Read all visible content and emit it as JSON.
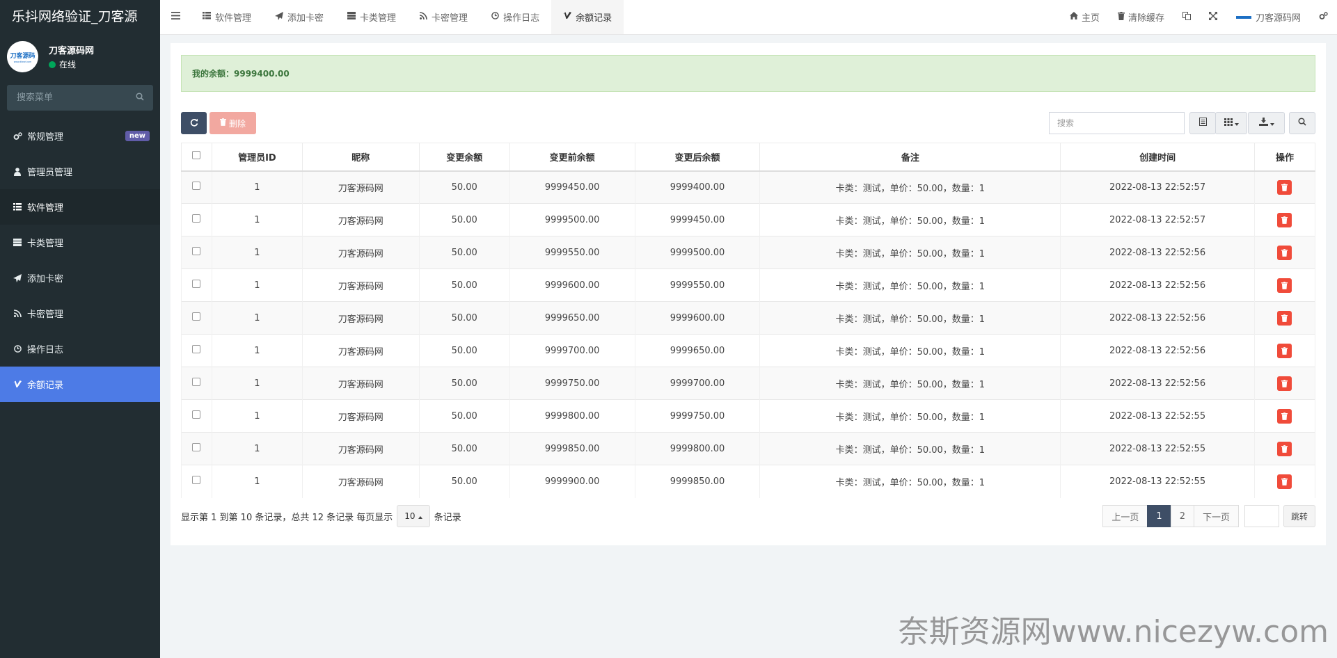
{
  "app": {
    "brand": "乐抖网络验证_刀客源",
    "user_name": "刀客源码网",
    "user_status": "在线",
    "avatar_text": "刀客源码",
    "avatar_subtext": "www.dkewl.com"
  },
  "sidebar": {
    "search_placeholder": "搜索菜单",
    "items": [
      {
        "label": "常规管理",
        "icon": "cogs-icon",
        "badge": "new"
      },
      {
        "label": "管理员管理",
        "icon": "user-icon"
      },
      {
        "label": "软件管理",
        "icon": "list-icon"
      },
      {
        "label": "卡类管理",
        "icon": "server-icon"
      },
      {
        "label": "添加卡密",
        "icon": "paper-plane-icon"
      },
      {
        "label": "卡密管理",
        "icon": "rss-icon"
      },
      {
        "label": "操作日志",
        "icon": "clock-icon"
      },
      {
        "label": "余额记录",
        "icon": "vimeo-icon"
      }
    ]
  },
  "topnav": {
    "tabs": [
      {
        "label": "软件管理"
      },
      {
        "label": "添加卡密"
      },
      {
        "label": "卡类管理"
      },
      {
        "label": "卡密管理"
      },
      {
        "label": "操作日志"
      },
      {
        "label": "余额记录"
      }
    ],
    "right": {
      "home": "主页",
      "clear_cache": "清除缓存",
      "user": "刀客源码网"
    }
  },
  "balance": {
    "label": "我的余额：9999400.00"
  },
  "toolbar": {
    "delete_label": "删除",
    "search_placeholder": "搜索"
  },
  "table": {
    "columns": [
      "管理员ID",
      "昵称",
      "变更余额",
      "变更前余额",
      "变更后余额",
      "备注",
      "创建时间",
      "操作"
    ],
    "rows": [
      {
        "admin_id": "1",
        "nickname": "刀客源码网",
        "change": "50.00",
        "before": "9999450.00",
        "after": "9999400.00",
        "remark": "卡类：测试，单价：50.00，数量：1",
        "time": "2022-08-13 22:52:57"
      },
      {
        "admin_id": "1",
        "nickname": "刀客源码网",
        "change": "50.00",
        "before": "9999500.00",
        "after": "9999450.00",
        "remark": "卡类：测试，单价：50.00，数量：1",
        "time": "2022-08-13 22:52:57"
      },
      {
        "admin_id": "1",
        "nickname": "刀客源码网",
        "change": "50.00",
        "before": "9999550.00",
        "after": "9999500.00",
        "remark": "卡类：测试，单价：50.00，数量：1",
        "time": "2022-08-13 22:52:56"
      },
      {
        "admin_id": "1",
        "nickname": "刀客源码网",
        "change": "50.00",
        "before": "9999600.00",
        "after": "9999550.00",
        "remark": "卡类：测试，单价：50.00，数量：1",
        "time": "2022-08-13 22:52:56"
      },
      {
        "admin_id": "1",
        "nickname": "刀客源码网",
        "change": "50.00",
        "before": "9999650.00",
        "after": "9999600.00",
        "remark": "卡类：测试，单价：50.00，数量：1",
        "time": "2022-08-13 22:52:56"
      },
      {
        "admin_id": "1",
        "nickname": "刀客源码网",
        "change": "50.00",
        "before": "9999700.00",
        "after": "9999650.00",
        "remark": "卡类：测试，单价：50.00，数量：1",
        "time": "2022-08-13 22:52:56"
      },
      {
        "admin_id": "1",
        "nickname": "刀客源码网",
        "change": "50.00",
        "before": "9999750.00",
        "after": "9999700.00",
        "remark": "卡类：测试，单价：50.00，数量：1",
        "time": "2022-08-13 22:52:56"
      },
      {
        "admin_id": "1",
        "nickname": "刀客源码网",
        "change": "50.00",
        "before": "9999800.00",
        "after": "9999750.00",
        "remark": "卡类：测试，单价：50.00，数量：1",
        "time": "2022-08-13 22:52:55"
      },
      {
        "admin_id": "1",
        "nickname": "刀客源码网",
        "change": "50.00",
        "before": "9999850.00",
        "after": "9999800.00",
        "remark": "卡类：测试，单价：50.00，数量：1",
        "time": "2022-08-13 22:52:55"
      },
      {
        "admin_id": "1",
        "nickname": "刀客源码网",
        "change": "50.00",
        "before": "9999900.00",
        "after": "9999850.00",
        "remark": "卡类：测试，单价：50.00，数量：1",
        "time": "2022-08-13 22:52:55"
      }
    ]
  },
  "pager": {
    "info_prefix": "显示第 1 到第 10 条记录，总共 12 条记录 每页显示",
    "page_size": "10",
    "info_suffix": "条记录",
    "prev": "上一页",
    "pages": [
      "1",
      "2"
    ],
    "next": "下一页",
    "jump": "跳转"
  },
  "watermark": "奈斯资源网www.nicezyw.com",
  "colors": {
    "sidebar_bg": "#222d32",
    "active_menu": "#4d7be6",
    "alert_bg": "#dff0d8",
    "danger": "#f04b3a",
    "primary_dark": "#3e4e66"
  }
}
